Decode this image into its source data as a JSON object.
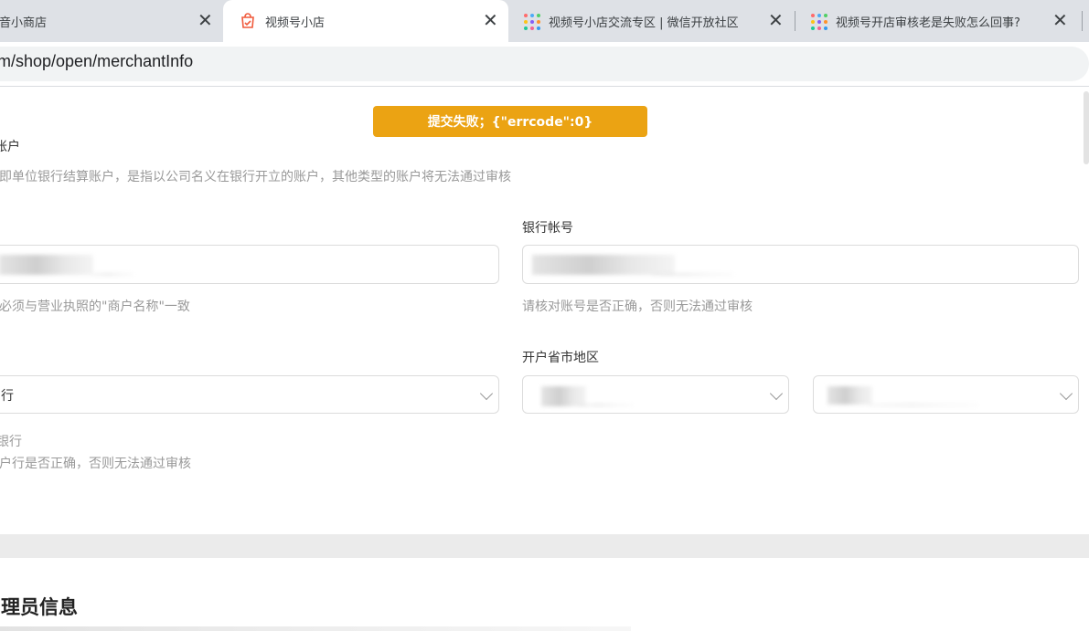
{
  "browser": {
    "tabs": [
      {
        "label": "音小商店",
        "active": false
      },
      {
        "label": "视频号小店",
        "active": true
      },
      {
        "label": "视频号小店交流专区 | 微信开放社区",
        "active": false
      },
      {
        "label": "视频号开店审核老是失败怎么回事?",
        "active": false
      }
    ],
    "url": "m/shop/open/merchantInfo",
    "close_glyph": "✕"
  },
  "toast": {
    "message": "提交失败；{\"errcode\":0}"
  },
  "bank_section": {
    "title_partial": "账户",
    "description": "即单位银行结算账户，是指以公司名义在银行开立的账户，其他类型的账户将无法通过审核",
    "account_name_hint": "必须与营业执照的\"商户名称\"一致",
    "account_number_label": "银行帐号",
    "account_number_hint": "请核对账号是否正确，否则无法通过审核",
    "bank_select_value": "行",
    "region_label": "开户省市地区",
    "branch_label_partial": "银行",
    "branch_hint": "户行是否正确，否则无法通过审核"
  },
  "admin_section": {
    "title": "理员信息"
  },
  "colors": {
    "toast_bg": "#eba313",
    "hint_text": "#999999",
    "section_divider": "#ebebeb"
  }
}
